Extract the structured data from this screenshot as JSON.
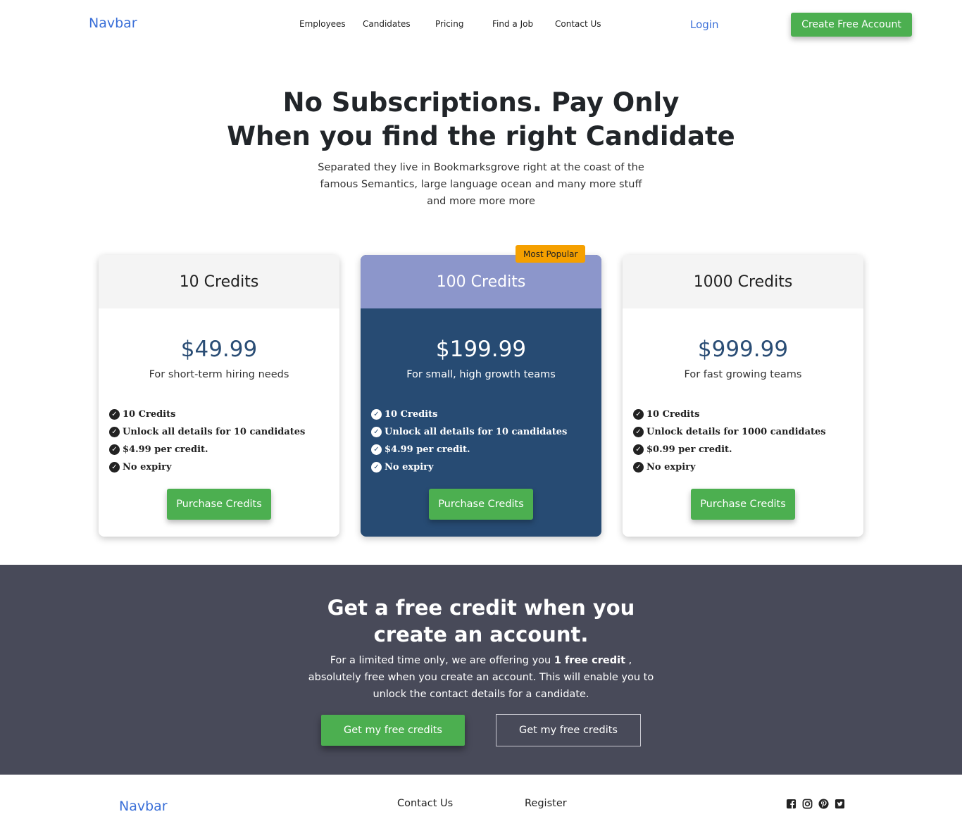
{
  "nav": {
    "brand": "Navbar",
    "links": [
      "Employees",
      "Candidates",
      "Pricing",
      "Find a Job",
      "Contact Us"
    ],
    "login": "Login",
    "cta": "Create Free Account"
  },
  "hero": {
    "title_line1": "No Subscriptions. Pay Only",
    "title_line2": "When you find the right Candidate",
    "subtitle": "Separated they live in Bookmarksgrove right at the coast of the famous Semantics, large language ocean and many more stuff and more more more"
  },
  "plans": [
    {
      "name": "10 Credits",
      "price": "$49.99",
      "desc": "For short-term hiring needs",
      "features": [
        "10 Credits",
        "Unlock all details for 10 candidates",
        "$4.99 per credit.",
        "No expiry"
      ],
      "button": "Purchase Credits"
    },
    {
      "name": "100 Credits",
      "badge": "Most Popular",
      "price": "$199.99",
      "desc": "For small, high growth teams",
      "features": [
        "10 Credits",
        "Unlock all details for 10 candidates",
        "$4.99 per credit.",
        "No expiry"
      ],
      "button": "Purchase Credits"
    },
    {
      "name": "1000 Credits",
      "price": "$999.99",
      "desc": "For fast growing teams",
      "features": [
        "10 Credits",
        "Unlock details for 1000 candidates",
        "$0.99 per credit.",
        "No expiry"
      ],
      "button": "Purchase Credits"
    }
  ],
  "promo": {
    "title_line1": "Get a free credit when you",
    "title_line2": "create an account.",
    "text_before": "For a limited time only, we are offering you ",
    "text_bold": "1 free credit",
    "text_after": " , absolutely free when you create an account. This will enable you to unlock the contact details for a candidate.",
    "button_primary": "Get my free credits",
    "button_secondary": "Get my free credits"
  },
  "footer": {
    "brand": "Navbar",
    "links": [
      "Contact Us",
      "Register"
    ],
    "socials": [
      "facebook-icon",
      "instagram-icon",
      "pinterest-icon",
      "twitter-icon"
    ]
  },
  "colors": {
    "accent_green": "#4caf50",
    "link_blue": "#3a6fd8",
    "price_blue": "#2a4d75",
    "featured_bg": "#274b73",
    "featured_head": "#8c96cb",
    "badge": "#f5a000",
    "promo_bg": "#484a59"
  }
}
